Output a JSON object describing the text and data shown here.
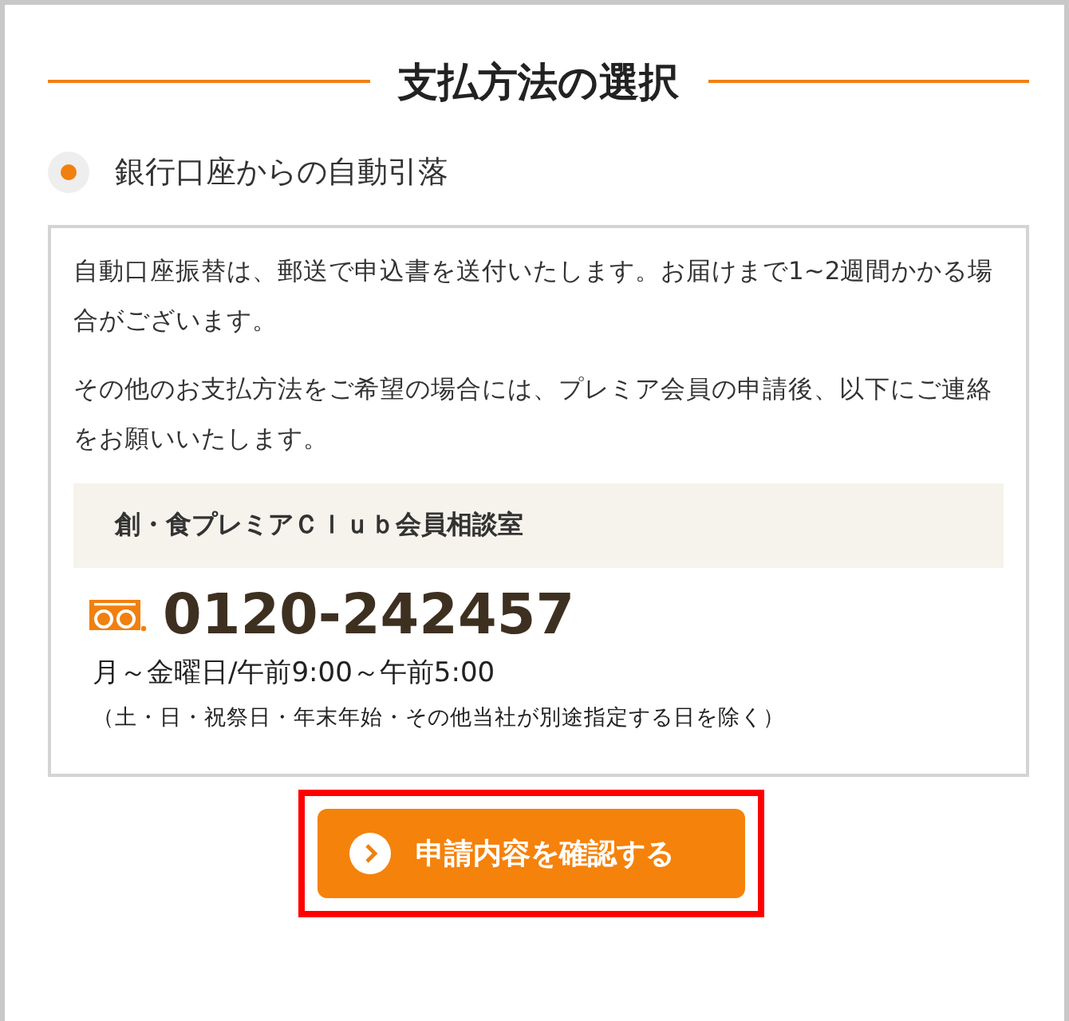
{
  "heading": "支払方法の選択",
  "payment_option": {
    "label": "銀行口座からの自動引落",
    "selected": true
  },
  "notice": {
    "paragraphs": [
      "自動口座振替は、郵送で申込書を送付いたします。お届けまで1~2週間かかる場合がございます。",
      "その他のお支払方法をご希望の場合には、プレミア会員の申請後、以下にご連絡をお願いいたします。"
    ],
    "contact": {
      "name": "創・食プレミアＣｌｕｂ会員相談室",
      "phone": "0120-242457",
      "hours": "月～金曜日/午前9:00～午前5:00",
      "note": "（土・日・祝祭日・年末年始・その他当社が別途指定する日を除く）"
    }
  },
  "confirm_button": {
    "label": "申請内容を確認する",
    "highlighted": true
  }
}
